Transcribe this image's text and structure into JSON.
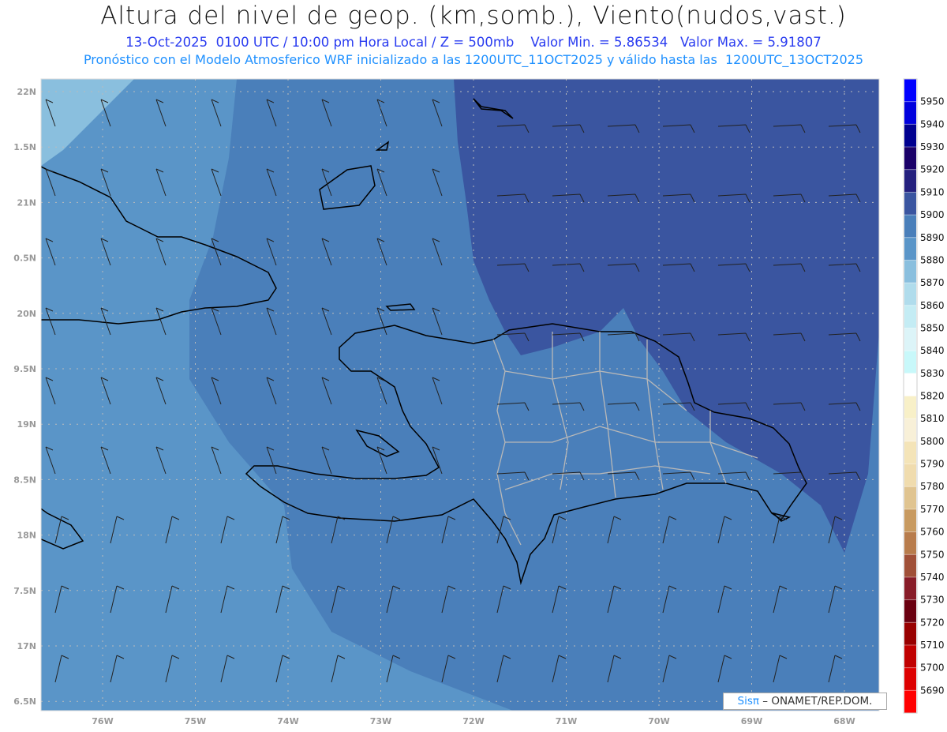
{
  "header": {
    "title": "Altura del nivel de geop. (km,somb.), Viento(nudos,vast.)",
    "subtitle": "13-Oct-2025  0100 UTC / 10:00 pm Hora Local / Z = 500mb    Valor Min. = 5.86534   Valor Max. = 5.91807",
    "model_info": "Pronóstico con el Modelo Atmosferico WRF inicializado a las 1200UTC_11OCT2025 y válido hasta las  1200UTC_13OCT2025"
  },
  "axes": {
    "lon_labels": [
      "76W",
      "75W",
      "74W",
      "73W",
      "72W",
      "71W",
      "70W",
      "69W",
      "68W"
    ],
    "lat_labels": [
      "22N",
      "1.5N",
      "21N",
      "0.5N",
      "20N",
      "9.5N",
      "19N",
      "8.5N",
      "18N",
      "7.5N",
      "17N",
      "6.5N"
    ]
  },
  "colorbar": {
    "labels": [
      "5950",
      "5940",
      "5930",
      "5920",
      "5910",
      "5900",
      "5890",
      "5880",
      "5870",
      "5860",
      "5850",
      "5840",
      "5830",
      "5820",
      "5810",
      "5800",
      "5790",
      "5780",
      "5770",
      "5760",
      "5750",
      "5740",
      "5730",
      "5720",
      "5710",
      "5700",
      "5690"
    ],
    "colors": [
      "#0000ff",
      "#0000dd",
      "#00008f",
      "#1a0068",
      "#24207e",
      "#3a55a0",
      "#4a7fba",
      "#5a95c8",
      "#8abfde",
      "#b0dcec",
      "#c4ecf4",
      "#dcf4f8",
      "#c8f8fa",
      "#ffffff",
      "#f8f0c8",
      "#f8f0d8",
      "#f4e4b8",
      "#f0dcae",
      "#e0c490",
      "#c89a60",
      "#b87c4c",
      "#a05038",
      "#881c28",
      "#6a0010",
      "#980000",
      "#c00000",
      "#dd0000",
      "#ff0000"
    ]
  },
  "logo": {
    "brand": "Sisπ",
    "org": " – ONAMET/REP.DOM."
  }
}
